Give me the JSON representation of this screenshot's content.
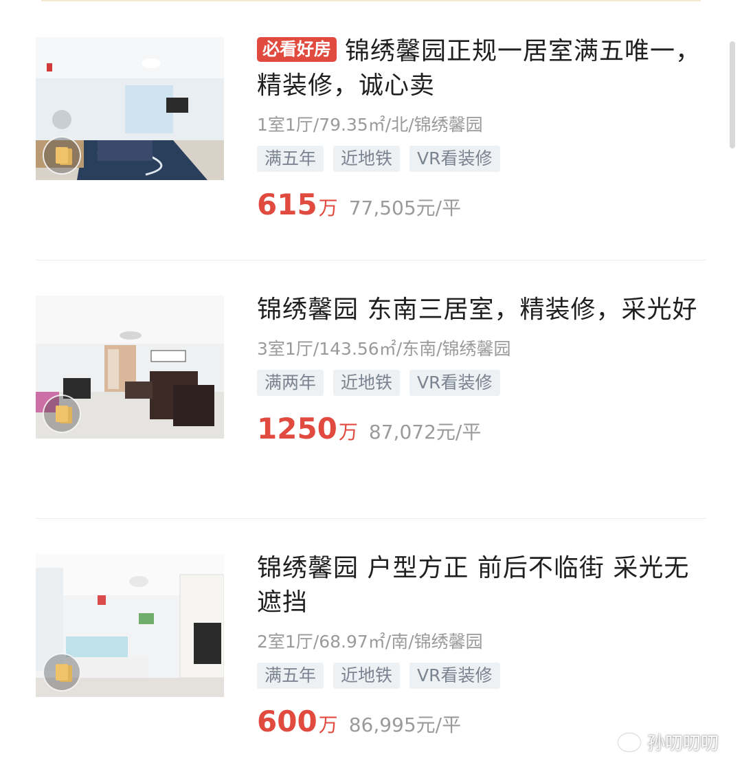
{
  "listings": [
    {
      "tag_label": "必看好房",
      "title": "锦绣馨园正规一居室满五唯一，精装修，诚心卖",
      "meta": "1室1厅/79.35㎡/北/锦绣馨园",
      "tags": [
        "满五年",
        "近地铁",
        "VR看装修"
      ],
      "price": "615",
      "price_unit": "万",
      "unit_price": "77,505元/平"
    },
    {
      "title": "锦绣馨园 东南三居室，精装修，采光好",
      "meta": "3室1厅/143.56㎡/东南/锦绣馨园",
      "tags": [
        "满两年",
        "近地铁",
        "VR看装修"
      ],
      "price": "1250",
      "price_unit": "万",
      "unit_price": "87,072元/平"
    },
    {
      "title": "锦绣馨园 户型方正 前后不临街 采光无遮挡",
      "meta": "2室1厅/68.97㎡/南/锦绣馨园",
      "tags": [
        "满五年",
        "近地铁",
        "VR看装修"
      ],
      "price": "600",
      "price_unit": "万",
      "unit_price": "86,995元/平"
    }
  ],
  "watermark": "孙叨叨叨",
  "colors": {
    "accent": "#e04a3f",
    "tag_bg": "#eef1f4",
    "tag_text": "#7a8390",
    "meta_text": "#9a9a9a"
  }
}
